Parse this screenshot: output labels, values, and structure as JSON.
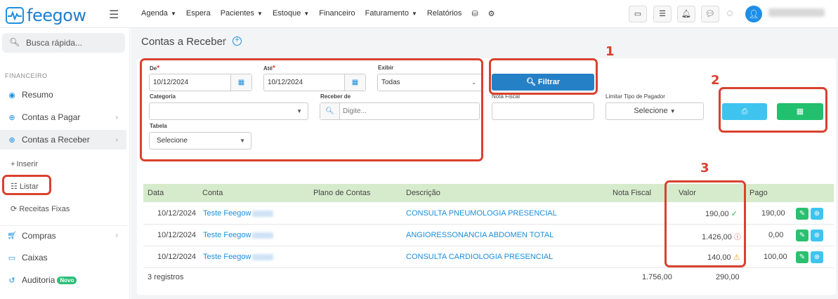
{
  "brand": {
    "name": "feegow"
  },
  "nav": {
    "menu": [
      {
        "label": "Agenda",
        "has_caret": true
      },
      {
        "label": "Espera",
        "has_caret": false
      },
      {
        "label": "Pacientes",
        "has_caret": true
      },
      {
        "label": "Estoque",
        "has_caret": true
      },
      {
        "label": "Financeiro",
        "has_caret": false
      },
      {
        "label": "Faturamento",
        "has_caret": true
      },
      {
        "label": "Relatórios",
        "has_caret": false
      }
    ],
    "icons": [
      "database-icon",
      "gear-icon",
      "inbox-icon",
      "checklist-icon",
      "bell-icon",
      "chat-icon",
      "user-avatar-icon"
    ]
  },
  "sidebar": {
    "search_placeholder": "Busca rápida...",
    "section_label": "FINANCEIRO",
    "items": [
      {
        "label": "Resumo",
        "icon": "palette-icon"
      },
      {
        "label": "Contas a Pagar",
        "icon": "arrow-up-circle-icon"
      },
      {
        "label": "Contas a Receber",
        "icon": "arrow-down-circle-icon"
      },
      {
        "label": "Compras",
        "icon": "cart-icon"
      },
      {
        "label": "Caixas",
        "icon": "tray-icon"
      },
      {
        "label": "Auditoria",
        "icon": "history-icon",
        "badge": "Novo"
      }
    ],
    "sub_items": [
      {
        "label": "Inserir",
        "icon": "plus-icon"
      },
      {
        "label": "Listar",
        "icon": "list-icon"
      },
      {
        "label": "Receitas Fixas",
        "icon": "refresh-icon"
      }
    ]
  },
  "page": {
    "title": "Contas a Receber",
    "separator": "/"
  },
  "filters": {
    "de_label": "De",
    "de_value": "10/12/2024",
    "ate_label": "Até",
    "ate_value": "10/12/2024",
    "exibir_label": "Exibir",
    "exibir_value": "Todas",
    "categoria_label": "Categoria",
    "categoria_value": "",
    "receber_de_label": "Receber de",
    "receber_de_placeholder": "Digite...",
    "tabela_label": "Tabela",
    "tabela_value": "Selecione",
    "nota_fiscal_label": "Nota Fiscal",
    "limitar_label": "Limitar Tipo de Pagador",
    "limitar_value": "Selecione",
    "filter_button": "Filtrar"
  },
  "annotations": [
    "1",
    "2",
    "3"
  ],
  "table": {
    "headers": [
      "Data",
      "Conta",
      "Plano de Contas",
      "Descrição",
      "Nota Fiscal",
      "Valor",
      "Pago"
    ],
    "rows": [
      {
        "data": "10/12/2024",
        "conta": "Teste Feegow",
        "plano": "",
        "descricao": "CONSULTA PNEUMOLOGIA PRESENCIAL",
        "nota": "",
        "valor": "190,00",
        "status": "ok",
        "pago": "190,00"
      },
      {
        "data": "10/12/2024",
        "conta": "Teste Feegow",
        "plano": "",
        "descricao": "ANGIORESSONANCIA ABDOMEN TOTAL",
        "nota": "",
        "valor": "1.426,00",
        "status": "error",
        "pago": "0,00"
      },
      {
        "data": "10/12/2024",
        "conta": "Teste Feegow",
        "plano": "",
        "descricao": "CONSULTA CARDIOLOGIA PRESENCIAL",
        "nota": "",
        "valor": "140,00",
        "status": "warning",
        "pago": "100,00"
      }
    ],
    "footer": {
      "count": "3 registros",
      "total_valor": "1.756,00",
      "total_pago": "290,00"
    }
  },
  "colors": {
    "brand": "#1e7fd0",
    "filter_button": "#2580c6",
    "print_button": "#3ec4ef",
    "excel_button": "#22c06e",
    "table_header": "#d6ebcc",
    "annotation": "#d9412f"
  }
}
